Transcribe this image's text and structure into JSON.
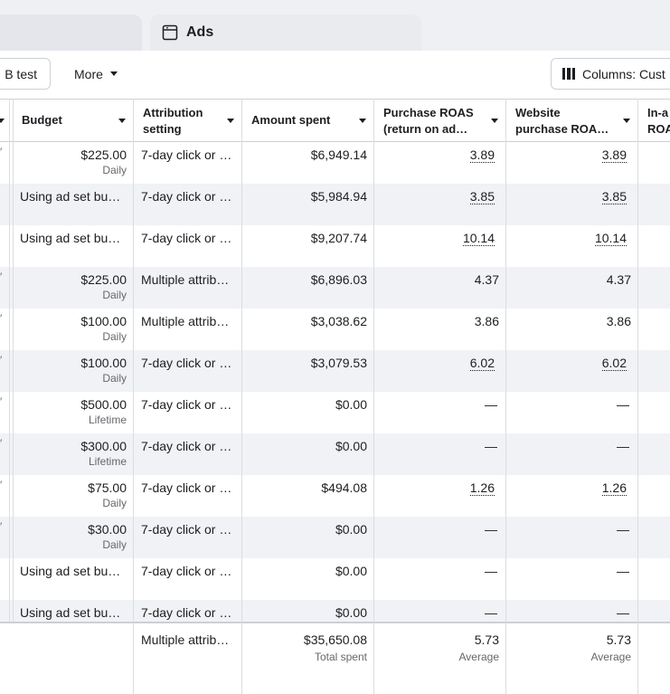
{
  "tabs": {
    "ads_label": "Ads"
  },
  "toolbar": {
    "ab_test_label": "B test",
    "more_label": "More",
    "columns_label": "Columns: Cust"
  },
  "headers": {
    "budget": "Budget",
    "attribution_line1": "Attribution",
    "attribution_line2": "setting",
    "amount_spent": "Amount spent",
    "purchase_roas_line1": "Purchase ROAS",
    "purchase_roas_line2": "(return on ad…",
    "website_roas_line1": "Website",
    "website_roas_line2": "purchase ROA…",
    "inapp_line1": "In-a",
    "inapp_line2": "ROA"
  },
  "rows": [
    {
      "budget": "$225.00",
      "budget_type": "Daily",
      "attribution": "7-day click or …",
      "spent": "$6,949.14",
      "purchase_roas": "3.89",
      "website_roas": "3.89"
    },
    {
      "budget": "Using ad set bu…",
      "budget_type": "",
      "attribution": "7-day click or …",
      "spent": "$5,984.94",
      "purchase_roas": "3.85",
      "website_roas": "3.85"
    },
    {
      "budget": "Using ad set bu…",
      "budget_type": "",
      "attribution": "7-day click or …",
      "spent": "$9,207.74",
      "purchase_roas": "10.14",
      "website_roas": "10.14"
    },
    {
      "budget": "$225.00",
      "budget_type": "Daily",
      "attribution": "Multiple attrib…",
      "spent": "$6,896.03",
      "purchase_roas": "4.37",
      "website_roas": "4.37"
    },
    {
      "budget": "$100.00",
      "budget_type": "Daily",
      "attribution": "Multiple attrib…",
      "spent": "$3,038.62",
      "purchase_roas": "3.86",
      "website_roas": "3.86"
    },
    {
      "budget": "$100.00",
      "budget_type": "Daily",
      "attribution": "7-day click or …",
      "spent": "$3,079.53",
      "purchase_roas": "6.02",
      "website_roas": "6.02"
    },
    {
      "budget": "$500.00",
      "budget_type": "Lifetime",
      "attribution": "7-day click or …",
      "spent": "$0.00",
      "purchase_roas": "—",
      "website_roas": "—"
    },
    {
      "budget": "$300.00",
      "budget_type": "Lifetime",
      "attribution": "7-day click or …",
      "spent": "$0.00",
      "purchase_roas": "—",
      "website_roas": "—"
    },
    {
      "budget": "$75.00",
      "budget_type": "Daily",
      "attribution": "7-day click or …",
      "spent": "$494.08",
      "purchase_roas": "1.26",
      "website_roas": "1.26"
    },
    {
      "budget": "$30.00",
      "budget_type": "Daily",
      "attribution": "7-day click or …",
      "spent": "$0.00",
      "purchase_roas": "—",
      "website_roas": "—"
    },
    {
      "budget": "Using ad set bu…",
      "budget_type": "",
      "attribution": "7-day click or …",
      "spent": "$0.00",
      "purchase_roas": "—",
      "website_roas": "—"
    },
    {
      "budget": "Using ad set bu…",
      "budget_type": "",
      "attribution": "7-day click or …",
      "spent": "$0.00",
      "purchase_roas": "—",
      "website_roas": "—"
    }
  ],
  "footer": {
    "attribution": "Multiple attrib…",
    "spent": "$35,650.08",
    "spent_sub": "Total spent",
    "purchase_roas": "5.73",
    "purchase_roas_sub": "Average",
    "website_roas": "5.73",
    "website_roas_sub": "Average"
  },
  "colors": {
    "alt_row": "#f0f2f5",
    "border": "#ccd0d5",
    "text": "#1c1e21",
    "secondary_text": "#65676b"
  }
}
